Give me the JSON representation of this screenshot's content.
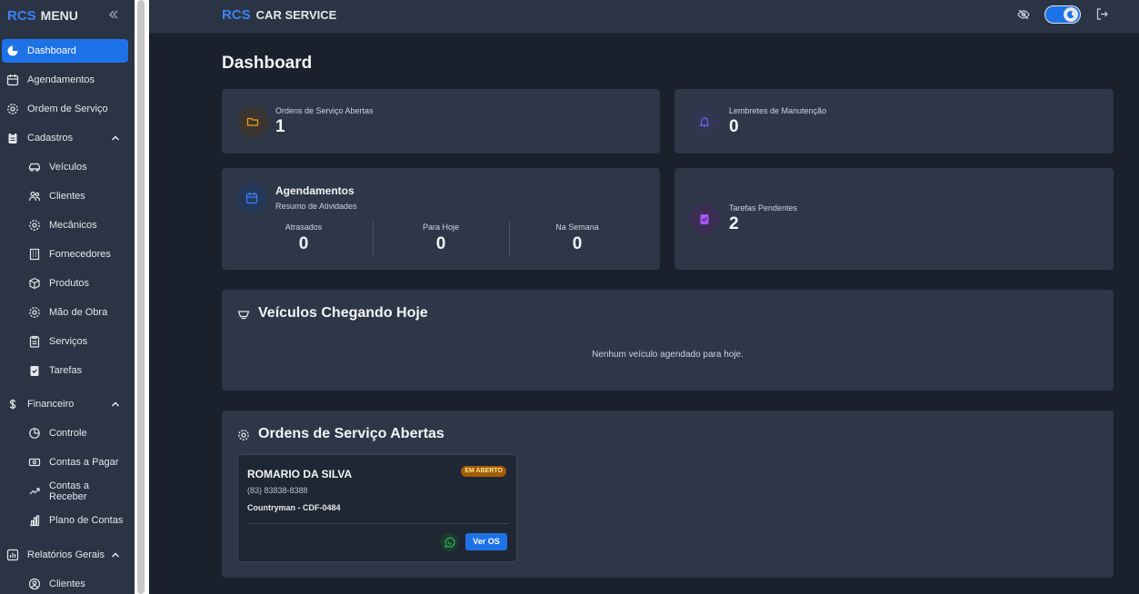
{
  "sidebar": {
    "logo_rcs": "RCS",
    "logo_menu": "MENU",
    "items": [
      {
        "label": "Dashboard"
      },
      {
        "label": "Agendamentos"
      },
      {
        "label": "Ordem de Serviço"
      },
      {
        "label": "Cadastros"
      },
      {
        "label": "Veículos"
      },
      {
        "label": "Clientes"
      },
      {
        "label": "Mecânicos"
      },
      {
        "label": "Fornecedores"
      },
      {
        "label": "Produtos"
      },
      {
        "label": "Mão de Obra"
      },
      {
        "label": "Serviços"
      },
      {
        "label": "Tarefas"
      },
      {
        "label": "Financeiro"
      },
      {
        "label": "Controle"
      },
      {
        "label": "Contas a Pagar"
      },
      {
        "label": "Contas a Receber"
      },
      {
        "label": "Plano de Contas"
      },
      {
        "label": "Relatórios Gerais"
      },
      {
        "label": "Clientes"
      }
    ]
  },
  "topbar": {
    "brand_rcs": "RCS",
    "brand_name": "CAR SERVICE"
  },
  "page": {
    "title": "Dashboard"
  },
  "stats": {
    "ordens_abertas": {
      "label": "Ordens de Serviço Abertas",
      "value": "1"
    },
    "lembretes": {
      "label": "Lembretes de Manutenção",
      "value": "0"
    },
    "tarefas": {
      "label": "Tarefas Pendentes",
      "value": "2"
    }
  },
  "agendamentos": {
    "title": "Agendamentos",
    "subtitle": "Resumo de Atividades",
    "columns": [
      {
        "label": "Atrasados",
        "value": "0"
      },
      {
        "label": "Para Hoje",
        "value": "0"
      },
      {
        "label": "Na Semana",
        "value": "0"
      }
    ]
  },
  "veiculos_hoje": {
    "title": "Veículos Chegando Hoje",
    "empty": "Nenhum veículo agendado para hoje."
  },
  "ordens_section": {
    "title": "Ordens de Serviço Abertas",
    "cards": [
      {
        "client": "ROMARIO DA SILVA",
        "status": "EM ABERTO",
        "phone": "(83) 83838-8388",
        "vehicle": "Countryman - CDF-0484",
        "button": "Ver OS"
      }
    ]
  },
  "colors": {
    "accent": "#1d72e8",
    "brand": "#3b82f6",
    "background": "#1a202c",
    "card": "#2d3748",
    "badge": "#a15c07"
  }
}
